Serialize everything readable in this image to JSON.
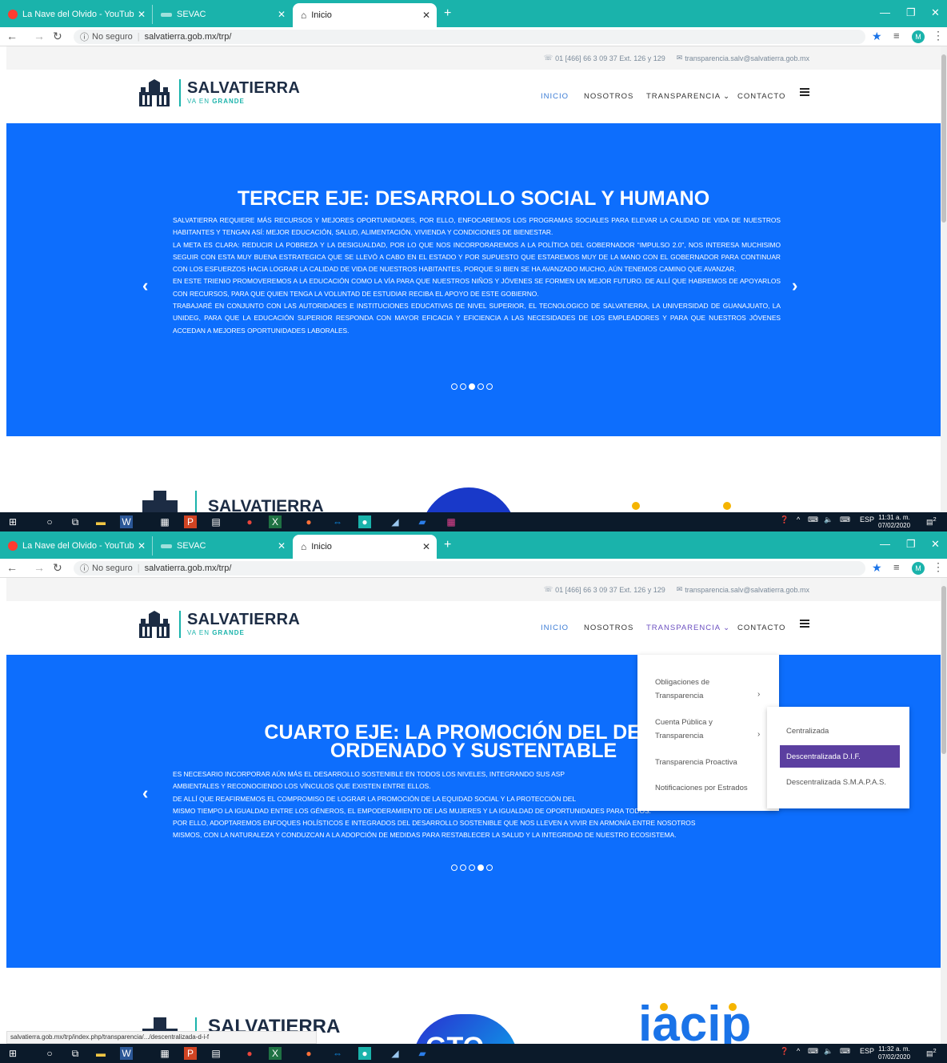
{
  "browser": {
    "tabs": [
      {
        "label": "La Nave del Olvido - YouTub"
      },
      {
        "label": "SEVAC"
      },
      {
        "label": "Inicio"
      }
    ],
    "url_security": "No seguro",
    "url": "salvatierra.gob.mx/trp/",
    "avatar_letter": "M"
  },
  "site": {
    "phone": "01 [466] 66 3 09 37 Ext. 126 y 129",
    "email": "transparencia.salv@salvatierra.gob.mx",
    "brand_name": "SALVATIERRA",
    "brand_tag_1": "VA EN ",
    "brand_tag_2": "GRANDE",
    "menu": {
      "inicio": "INICIO",
      "nosotros": "NOSOTROS",
      "transparencia": "TRANSPARENCIA ⌄",
      "contacto": "CONTACTO"
    }
  },
  "shotA": {
    "hero_title": "TERCER EJE: DESARROLLO SOCIAL Y HUMANO",
    "hero_paragraphs": [
      "SALVATIERRA REQUIERE MÁS RECURSOS Y MEJORES OPORTUNIDADES, POR ELLO, ENFOCAREMOS LOS PROGRAMAS SOCIALES PARA ELEVAR LA CALIDAD DE VIDA DE NUESTROS HABITANTES Y TENGAN ASÍ: MEJOR EDUCACIÓN, SALUD, ALIMENTACIÓN, VIVIENDA Y CONDICIONES DE BIENESTAR.",
      "LA META ES CLARA: REDUCIR LA POBREZA Y LA DESIGUALDAD, POR LO QUE NOS INCORPORAREMOS A LA POLÍTICA DEL GOBERNADOR “IMPULSO 2.0”, NOS INTERESA MUCHISIMO SEGUIR CON ESTA MUY BUENA ESTRATEGICA QUE SE LLEVÓ A CABO EN EL ESTADO Y POR SUPUESTO QUE ESTAREMOS MUY DE LA MANO CON EL GOBERNADOR PARA CONTINUAR CON LOS ESFUERZOS HACIA LOGRAR LA CALIDAD DE VIDA DE NUESTROS HABITANTES, PORQUE SI BIEN SE HA AVANZADO MUCHO, AÚN TENEMOS CAMINO QUE AVANZAR.",
      "EN ESTE TRIENIO PROMOVEREMOS A LA EDUCACIÓN COMO LA VÍA PARA QUE NUESTROS NIÑOS Y JÓVENES SE FORMEN UN MEJOR FUTURO. DE ALLÍ QUE HABREMOS DE APOYARLOS CON RECURSOS, PARA QUE QUIEN TENGA LA VOLUNTAD DE ESTUDIAR RECIBA EL APOYO DE ESTE GOBIERNO.",
      "TRABAJARÉ EN CONJUNTO CON LAS AUTORIDADES E INSTITUCIONES EDUCATIVAS DE NIVEL SUPERIOR, EL TECNOLOGICO DE SALVATIERRA, LA UNIVERSIDAD DE GUANAJUATO, LA UNIDEG, PARA QUE LA EDUCACIÓN SUPERIOR RESPONDA CON MAYOR EFICACIA Y EFICIENCIA A LAS NECESIDADES DE LOS EMPLEADORES Y PARA QUE NUESTROS JÓVENES ACCEDAN A MEJORES OPORTUNIDADES LABORALES."
    ],
    "clock_time": "11:31 a. m.",
    "clock_date": "07/02/2020"
  },
  "shotB": {
    "hero_title_1": "CUARTO EJE: LA PROMOCIÓN DEL DESAR",
    "hero_title_2": "ORDENADO Y SUSTENTABLE",
    "hero_lines": [
      "ES NECESARIO INCORPORAR AÚN MÁS EL DESARROLLO SOSTENIBLE EN TODOS LOS NIVELES, INTEGRANDO SUS ASP",
      "AMBIENTALES Y RECONOCIENDO LOS VÍNCULOS QUE EXISTEN ENTRE ELLOS.",
      "DE ALLÍ QUE REAFIRMEMOS EL COMPROMISO DE LOGRAR LA PROMOCIÓN DE LA EQUIDAD SOCIAL Y LA PROTECCIÓN DEL",
      "MISMO TIEMPO LA IGUALDAD ENTRE LOS GÉNEROS, EL EMPODERAMIENTO DE LAS MUJERES Y LA IGUALDAD DE OPORTUNIDADES PARA TODOS.",
      "POR ELLO, ADOPTAREMOS ENFOQUES HOLÍSTICOS E INTEGRADOS DEL DESARROLLO SOSTENIBLE QUE NOS LLEVEN A VIVIR EN ARMONÍA ENTRE NOSOTROS",
      "MISMOS, CON LA NATURALEZA Y CONDUZCAN A LA ADOPCIÓN DE MEDIDAS PARA RESTABLECER LA SALUD Y LA INTEGRIDAD DE NUESTRO ECOSISTEMA."
    ],
    "dropdown": {
      "obligaciones_1": "Obligaciones de",
      "obligaciones_2": "Transparencia",
      "cuenta_1": "Cuenta Pública y",
      "cuenta_2": "Transparencia",
      "proactiva": "Transparencia Proactiva",
      "notificaciones": "Notificaciones por Estrados"
    },
    "submenu": [
      "Centralizada",
      "Descentralizada D.I.F.",
      "Descentralizada S.M.A.P.A.S."
    ],
    "logo_gto": "GTO",
    "logo_iacip": "iacip",
    "status_url": "salvatierra.gob.mx/trp/index.php/transparencia/.../descentralizada-d-i-f",
    "clock_time": "11:32 a. m.",
    "clock_date": "07/02/2020"
  },
  "taskbar": {
    "lang": "ESP",
    "notif_count": "2"
  },
  "colors": {
    "tabstrip": "#1ab3ab",
    "hero": "#0d6efd",
    "submenu_selected": "#5b3fa0",
    "brand_navy": "#1c2c44"
  }
}
